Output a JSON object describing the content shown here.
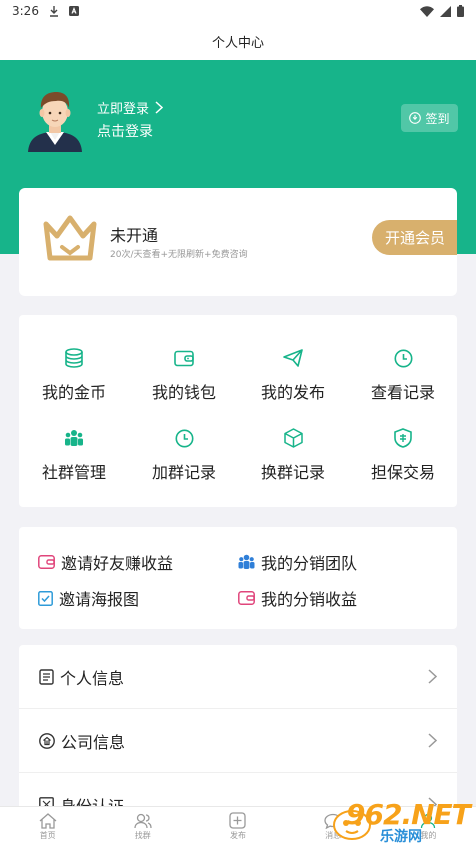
{
  "status_bar": {
    "time": "3:26"
  },
  "nav": {
    "title": "个人中心"
  },
  "profile": {
    "login_link": "立即登录",
    "login_sub": "点击登录",
    "checkin_label": "签到"
  },
  "vip": {
    "title": "未开通",
    "desc": "20次/天查看+无限刷新+免费咨询",
    "button": "开通会员"
  },
  "grid": [
    {
      "label": "我的金币",
      "icon": "coins-icon"
    },
    {
      "label": "我的钱包",
      "icon": "wallet-icon"
    },
    {
      "label": "我的发布",
      "icon": "send-icon"
    },
    {
      "label": "查看记录",
      "icon": "clock-icon"
    },
    {
      "label": "社群管理",
      "icon": "group-icon"
    },
    {
      "label": "加群记录",
      "icon": "clock-icon"
    },
    {
      "label": "换群记录",
      "icon": "cube-icon"
    },
    {
      "label": "担保交易",
      "icon": "shield-icon"
    }
  ],
  "invite": [
    {
      "label": "邀请好友赚收益",
      "icon": "wallet-pink-icon"
    },
    {
      "label": "我的分销团队",
      "icon": "team-icon"
    },
    {
      "label": "邀请海报图",
      "icon": "checkbox-icon"
    },
    {
      "label": "我的分销收益",
      "icon": "wallet-pink-icon"
    }
  ],
  "menu": [
    {
      "label": "个人信息",
      "icon": "document-icon"
    },
    {
      "label": "公司信息",
      "icon": "company-icon"
    },
    {
      "label": "身份认证",
      "icon": "id-icon"
    }
  ],
  "tabs": [
    {
      "label": "首页",
      "icon": "home-icon"
    },
    {
      "label": "找群",
      "icon": "people-icon"
    },
    {
      "label": "发布",
      "icon": "plus-icon"
    },
    {
      "label": "消息",
      "icon": "message-icon"
    },
    {
      "label": "我的",
      "icon": "user-icon"
    }
  ],
  "watermark": {
    "text": "962.NET",
    "sub": "乐游网"
  },
  "colors": {
    "brand": "#17b48a",
    "gold": "#d8b06d",
    "pink": "#e0457b",
    "blue": "#2f7fd8"
  }
}
